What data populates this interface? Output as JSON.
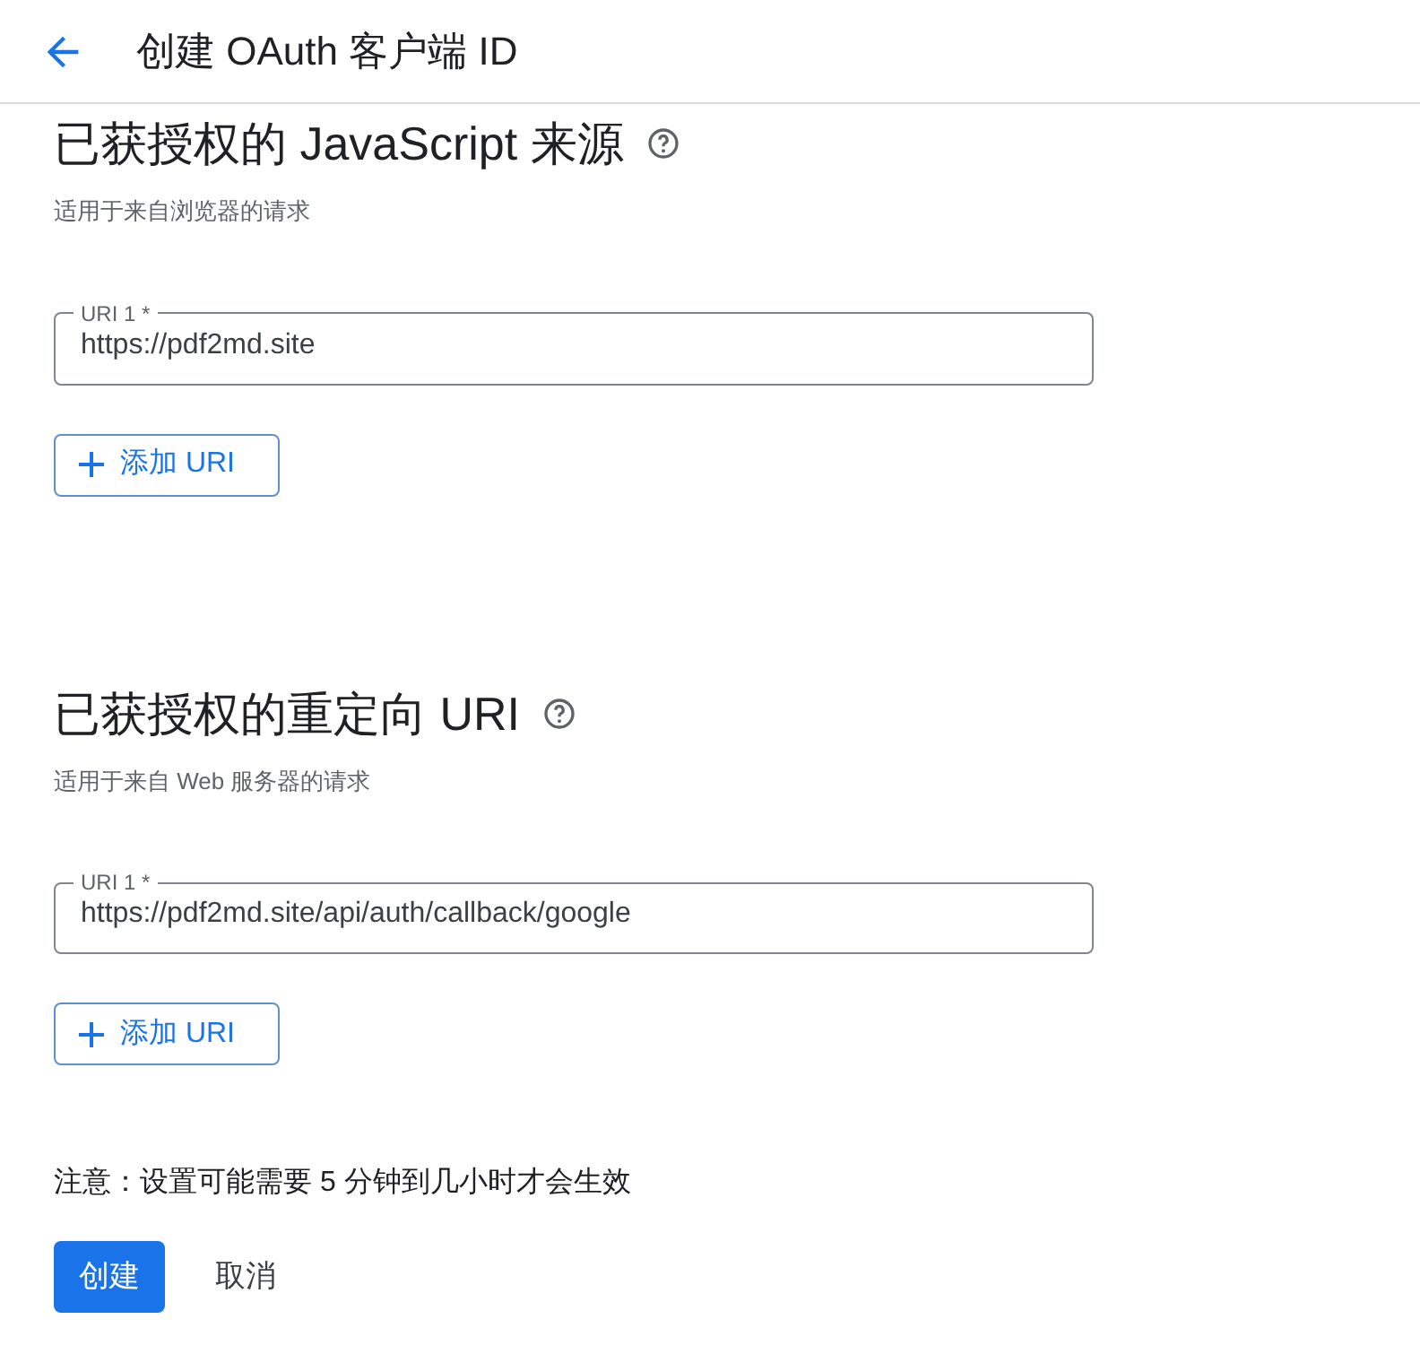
{
  "header": {
    "title": "创建 OAuth 客户端 ID"
  },
  "sections": [
    {
      "title": "已获授权的 JavaScript 来源",
      "subtitle": "适用于来自浏览器的请求",
      "fields": [
        {
          "label": "URI 1 *",
          "value": "https://pdf2md.site"
        }
      ],
      "add_button": "添加 URI"
    },
    {
      "title": "已获授权的重定向 URI",
      "subtitle": "适用于来自 Web 服务器的请求",
      "fields": [
        {
          "label": "URI 1 *",
          "value": "https://pdf2md.site/api/auth/callback/google"
        }
      ],
      "add_button": "添加 URI"
    }
  ],
  "note": "注意：设置可能需要 5 分钟到几小时才会生效",
  "actions": [
    {
      "label": "创建",
      "kind": "primary"
    },
    {
      "label": "取消",
      "kind": "text"
    }
  ]
}
